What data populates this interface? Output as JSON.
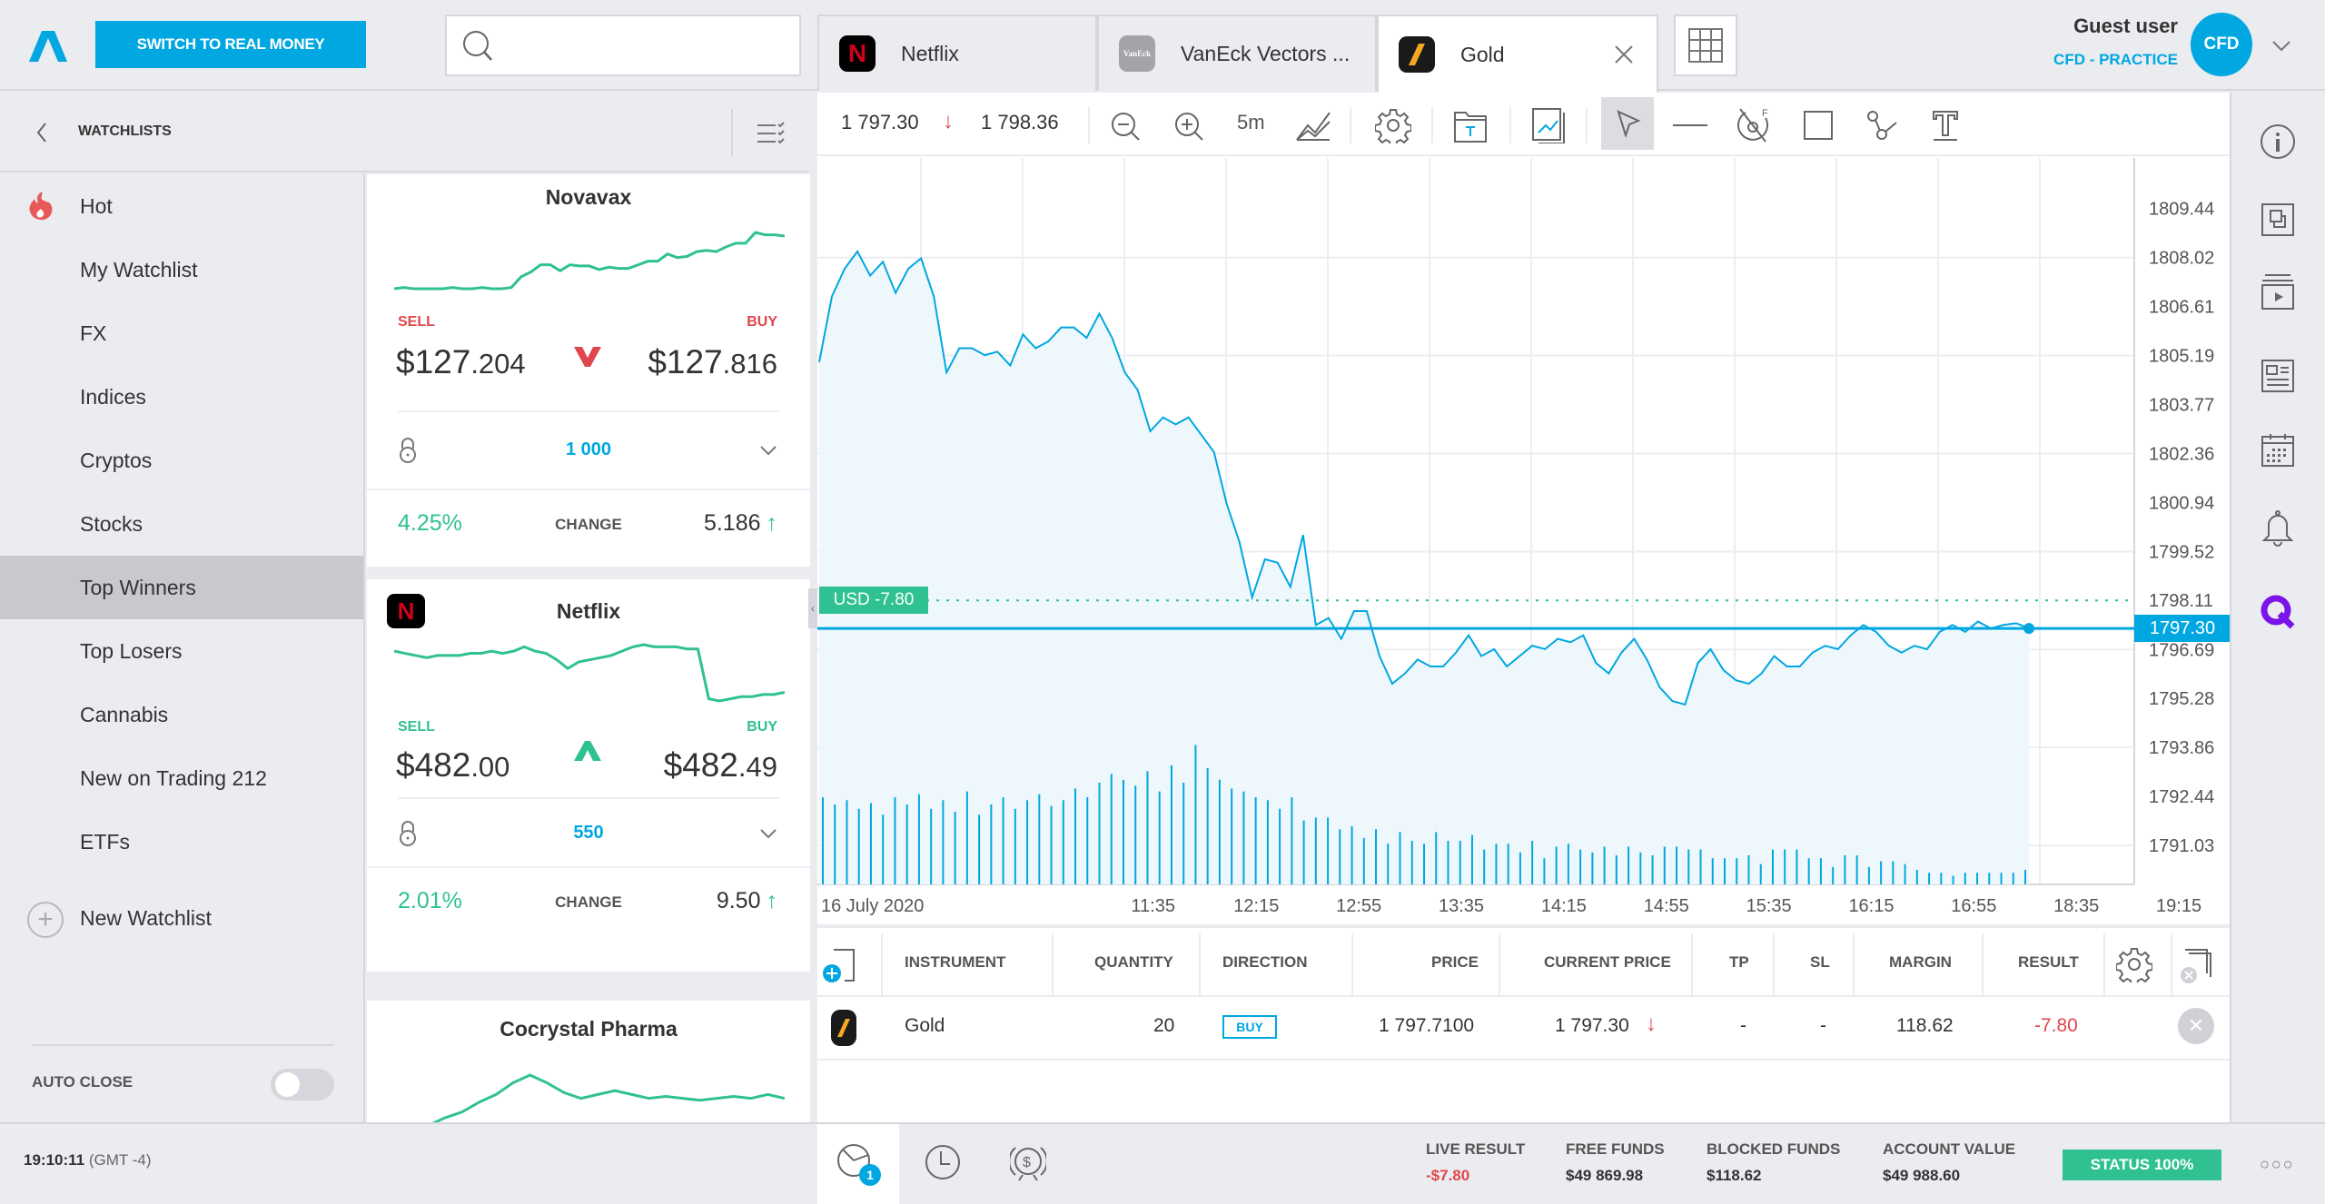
{
  "topbar": {
    "switch_label": "SWITCH TO REAL MONEY",
    "search_placeholder": "",
    "tabs": [
      {
        "label": "Netflix",
        "icon": "netflix-logo"
      },
      {
        "label": "VanEck Vectors ...",
        "icon": "vaneck-logo",
        "icon_text": "VanEck"
      },
      {
        "label": "Gold",
        "icon": "gold-logo",
        "active": true
      }
    ],
    "user_name": "Guest user",
    "account_mode": "CFD - PRACTICE",
    "avatar_text": "CFD"
  },
  "watchlists": {
    "title": "WATCHLISTS",
    "items": [
      {
        "label": "Hot",
        "icon": "fire-icon"
      },
      {
        "label": "My Watchlist"
      },
      {
        "label": "FX"
      },
      {
        "label": "Indices"
      },
      {
        "label": "Cryptos"
      },
      {
        "label": "Stocks"
      },
      {
        "label": "Top Winners",
        "active": true
      },
      {
        "label": "Top Losers"
      },
      {
        "label": "Cannabis"
      },
      {
        "label": "New on Trading 212"
      },
      {
        "label": "ETFs"
      }
    ],
    "new_watchlist": "New Watchlist",
    "auto_close": "AUTO CLOSE",
    "auto_close_on": false
  },
  "clock": {
    "time": "19:10:11",
    "tz": "(GMT -4)"
  },
  "cards": [
    {
      "name": "Novavax",
      "sell_label": "SELL",
      "buy_label": "BUY",
      "sell_int": "$127",
      "sell_dec": ".204",
      "buy_int": "$127",
      "buy_dec": ".816",
      "direction": "down",
      "quantity": "1 000",
      "change_pct": "4.25%",
      "change_label": "CHANGE",
      "change_val": "5.186",
      "label_color": "#e0474c",
      "spark": [
        10,
        11,
        10,
        10,
        10,
        10,
        11,
        10,
        10,
        11,
        10,
        10,
        11,
        20,
        24,
        30,
        30,
        25,
        30,
        29,
        29,
        26,
        28,
        27,
        27,
        30,
        33,
        33,
        39,
        36,
        37,
        41,
        42,
        41,
        45,
        48,
        48,
        57,
        55,
        55,
        54
      ]
    },
    {
      "name": "Netflix",
      "sell_label": "SELL",
      "buy_label": "BUY",
      "sell_int": "$482",
      "sell_dec": ".00",
      "buy_int": "$482",
      "buy_dec": ".49",
      "direction": "up",
      "quantity": "550",
      "change_pct": "2.01%",
      "change_label": "CHANGE",
      "change_val": "9.50",
      "label_color": "#2fc191",
      "spark": [
        56,
        55,
        54,
        53,
        54,
        54,
        54,
        55,
        55,
        56,
        55,
        56,
        58,
        56,
        55,
        52,
        48,
        51,
        52,
        53,
        54,
        56,
        58,
        59,
        58,
        58,
        58,
        57,
        57,
        34,
        33,
        34,
        35,
        35,
        36,
        36,
        37
      ]
    },
    {
      "name": "Cocrystal Pharma",
      "spark": [
        5,
        6,
        8,
        12,
        15,
        20,
        24,
        30,
        34,
        30,
        25,
        22,
        24,
        26,
        24,
        22,
        23,
        22,
        21,
        22,
        23,
        22,
        24,
        22
      ]
    }
  ],
  "chart": {
    "instrument": "Gold",
    "sell_price": "1 797.30",
    "buy_price": "1 798.36",
    "interval": "5m",
    "usd_label": "USD -7.80",
    "current_tag": "1797.30"
  },
  "chart_data": {
    "type": "line",
    "title": "Gold",
    "x_labels": [
      "16 July 2020",
      "11:35",
      "12:15",
      "12:55",
      "13:35",
      "14:15",
      "14:55",
      "15:35",
      "16:15",
      "16:55",
      "18:35",
      "19:15"
    ],
    "y_ticks": [
      1809.44,
      1808.02,
      1806.61,
      1805.19,
      1803.77,
      1802.36,
      1800.94,
      1799.52,
      1798.11,
      1796.69,
      1795.28,
      1793.86,
      1792.44,
      1791.03
    ],
    "ylim": [
      1789.9,
      1810.9
    ],
    "current_price": 1797.3,
    "open_price_line": 1798.11,
    "price": [
      1805.0,
      1806.9,
      1807.7,
      1808.2,
      1807.5,
      1807.9,
      1807.0,
      1807.7,
      1808.0,
      1806.9,
      1804.7,
      1805.4,
      1805.4,
      1805.2,
      1805.3,
      1804.9,
      1805.8,
      1805.4,
      1805.6,
      1806.0,
      1806.0,
      1805.7,
      1806.4,
      1805.7,
      1804.7,
      1804.2,
      1803.0,
      1803.4,
      1803.2,
      1803.4,
      1802.9,
      1802.4,
      1800.9,
      1799.8,
      1798.2,
      1799.3,
      1799.2,
      1798.5,
      1800.0,
      1797.4,
      1797.6,
      1797.0,
      1797.8,
      1797.8,
      1796.5,
      1795.7,
      1796.0,
      1796.4,
      1796.2,
      1796.2,
      1796.6,
      1797.1,
      1796.5,
      1796.7,
      1796.2,
      1796.5,
      1796.8,
      1796.7,
      1797.0,
      1796.9,
      1797.1,
      1796.3,
      1796.0,
      1796.6,
      1797.0,
      1796.4,
      1795.6,
      1795.2,
      1795.1,
      1796.3,
      1796.7,
      1796.1,
      1795.8,
      1795.7,
      1796.0,
      1796.5,
      1796.2,
      1796.2,
      1796.6,
      1796.8,
      1796.7,
      1797.1,
      1797.4,
      1797.2,
      1796.8,
      1796.6,
      1796.8,
      1796.7,
      1797.2,
      1797.4,
      1797.2,
      1797.5,
      1797.3,
      1797.4,
      1797.45,
      1797.3
    ],
    "volume": [
      60,
      55,
      58,
      52,
      56,
      48,
      60,
      55,
      62,
      52,
      58,
      50,
      64,
      48,
      55,
      60,
      52,
      58,
      62,
      54,
      58,
      66,
      60,
      70,
      76,
      72,
      68,
      78,
      64,
      82,
      70,
      96,
      80,
      72,
      66,
      64,
      60,
      58,
      52,
      60,
      44,
      46,
      46,
      38,
      40,
      32,
      38,
      28,
      36,
      30,
      28,
      36,
      30,
      30,
      34,
      24,
      28,
      28,
      22,
      30,
      18,
      26,
      28,
      24,
      22,
      26,
      20,
      26,
      22,
      20,
      26,
      26,
      24,
      24,
      18,
      18,
      18,
      20,
      14,
      24,
      24,
      24,
      18,
      18,
      12,
      20,
      20,
      12,
      16,
      16,
      14,
      10,
      8,
      8,
      6,
      8,
      8,
      8,
      8,
      8,
      10
    ]
  },
  "positions": {
    "headers": [
      "INSTRUMENT",
      "QUANTITY",
      "DIRECTION",
      "PRICE",
      "CURRENT PRICE",
      "TP",
      "SL",
      "MARGIN",
      "RESULT"
    ],
    "rows": [
      {
        "instrument": "Gold",
        "quantity": "20",
        "direction": "BUY",
        "price": "1 797.7100",
        "current_price": "1 797.30",
        "tp": "-",
        "sl": "-",
        "margin": "118.62",
        "result": "-7.80"
      }
    ]
  },
  "footer": {
    "open_positions_count": "1",
    "live_result_label": "LIVE RESULT",
    "live_result": "-$7.80",
    "free_funds_label": "FREE FUNDS",
    "free_funds": "$49 869.98",
    "blocked_funds_label": "BLOCKED FUNDS",
    "blocked_funds": "$118.62",
    "account_value_label": "ACCOUNT VALUE",
    "account_value": "$49 988.60",
    "status_label": "STATUS 100%"
  },
  "colors": {
    "accent": "#00a7e1",
    "positive": "#2fc191",
    "negative": "#e0474c"
  }
}
